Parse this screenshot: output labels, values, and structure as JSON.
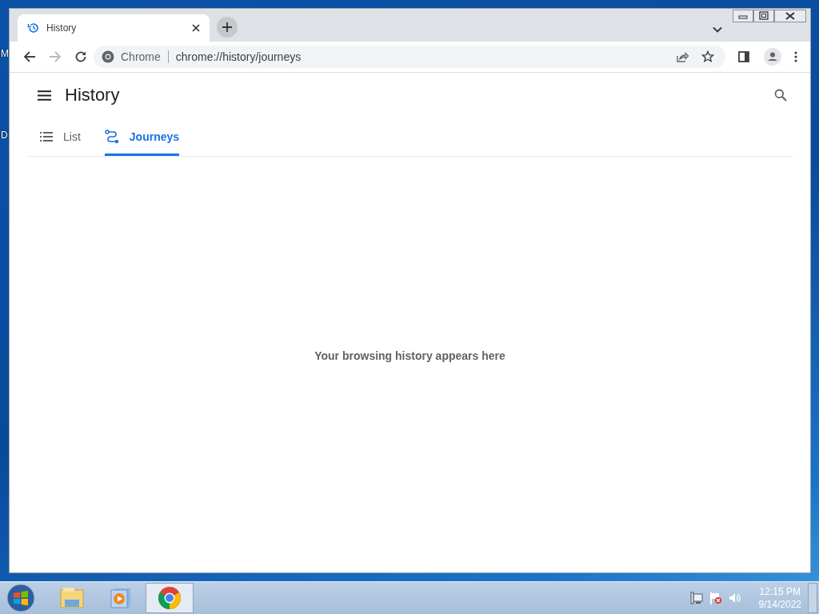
{
  "desktop": {
    "labels": [
      "M",
      "D"
    ]
  },
  "browser": {
    "tabs": [
      {
        "title": "History",
        "selected": true
      }
    ],
    "nav": {
      "back_disabled": false,
      "forward_disabled": true
    },
    "address": {
      "chip": "Chrome",
      "url": "chrome://history/journeys"
    }
  },
  "page": {
    "title": "History",
    "tabs": [
      {
        "label": "List",
        "kind": "list",
        "selected": false
      },
      {
        "label": "Journeys",
        "kind": "journeys",
        "selected": true
      }
    ],
    "empty_message": "Your browsing history appears here"
  },
  "taskbar": {
    "apps": [
      {
        "kind": "explorer",
        "selected": false
      },
      {
        "kind": "media",
        "selected": false
      },
      {
        "kind": "chrome",
        "selected": true
      }
    ],
    "clock": {
      "time": "12:15 PM",
      "date": "9/14/2022"
    }
  }
}
